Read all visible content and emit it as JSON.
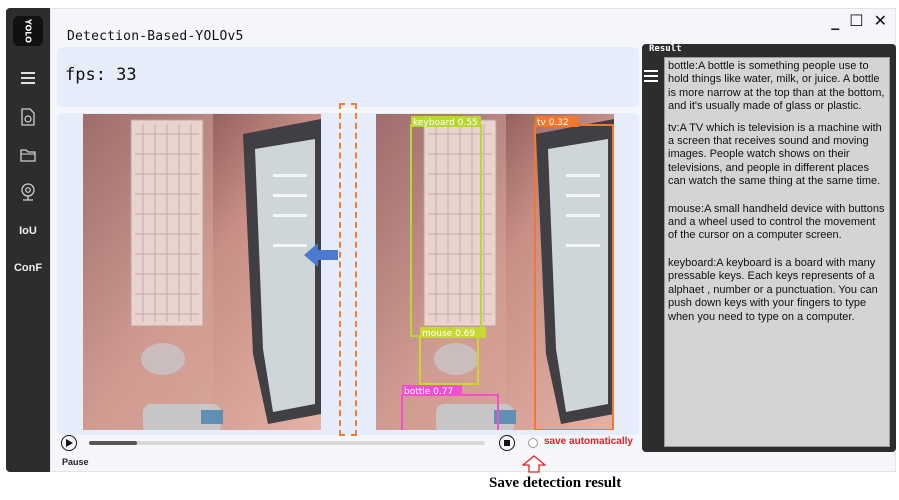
{
  "window": {
    "title": "Detection-Based-YOLOv5",
    "controls": {
      "minimize": "_",
      "maximize": "☐",
      "close": "✕"
    }
  },
  "logo": {
    "text": "YOLO"
  },
  "sidebar": {
    "items": [
      {
        "name": "menu",
        "icon": "hamburger-icon"
      },
      {
        "name": "image",
        "icon": "image-icon"
      },
      {
        "name": "folder",
        "icon": "folder-icon"
      },
      {
        "name": "camera",
        "icon": "webcam-icon"
      },
      {
        "name": "iou",
        "label": "IoU"
      },
      {
        "name": "conf",
        "label": "ConF"
      }
    ]
  },
  "stats": {
    "fps_label": "fps: 33"
  },
  "detections": [
    {
      "label": "keyboard 0.55",
      "color": "#b8d63a"
    },
    {
      "label": "tv 0.32",
      "color": "#f07830"
    },
    {
      "label": "mouse 0.69",
      "color": "#c8d830"
    },
    {
      "label": "bottle 0.77",
      "color": "#f050d0"
    }
  ],
  "controls": {
    "play_state": "Pause",
    "progress": 0.12,
    "save_label": "save automatically",
    "save_checked": false
  },
  "result": {
    "title": "Result",
    "entries": [
      "bottle:A bottle is something people use to hold things like water, milk, or juice. A bottle is more narrow at the top than at the bottom, and it's usually made of glass or plastic.",
      "tv:A TV which is television is a machine with a screen that receives sound and moving images. People watch shows on their televisions, and people in different places can watch the same thing at the same time.",
      "mouse:A small handheld device with buttons and a wheel used to control the movement of the cursor on a computer screen.",
      "keyboard:A keyboard is a board with many pressable keys. Each keys represents of a alphaet , number or a punctuation. You can push down keys with your fingers to type when you need to type on a computer."
    ]
  },
  "annotation": {
    "caption": "Save detection result"
  },
  "colors": {
    "sidebar": "#2d2d2d",
    "panel": "#e7ecfb",
    "accent_dash": "#f08030",
    "save_text": "#e02020",
    "arrow": "#4a7bd0"
  }
}
